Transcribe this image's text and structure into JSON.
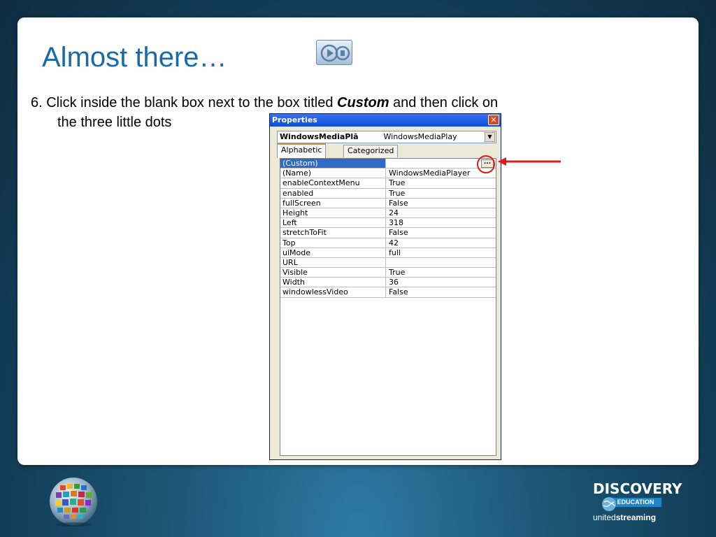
{
  "slide": {
    "title": "Almost there…",
    "instruction": {
      "line1_before": "6.  Click inside the blank box next to the box titled ",
      "emphasis": "Custom",
      "line1_after": " and then click on",
      "line2": "the three little dots"
    }
  },
  "properties_window": {
    "title": "Properties",
    "close_glyph": "✕",
    "object_name": "WindowsMediaPlā",
    "object_type": "WindowsMediaPlay",
    "dropdown_glyph": "▼",
    "tabs": [
      "Alphabetic",
      "Categorized"
    ],
    "active_tab": "Alphabetic",
    "ellipsis_label": "...",
    "rows": [
      {
        "name": "(Custom)",
        "value": ""
      },
      {
        "name": "(Name)",
        "value": "WindowsMediaPlayer"
      },
      {
        "name": "enableContextMenu",
        "value": "True"
      },
      {
        "name": "enabled",
        "value": "True"
      },
      {
        "name": "fullScreen",
        "value": "False"
      },
      {
        "name": "Height",
        "value": "24"
      },
      {
        "name": "Left",
        "value": "318"
      },
      {
        "name": "stretchToFit",
        "value": "False"
      },
      {
        "name": "Top",
        "value": "42"
      },
      {
        "name": "uiMode",
        "value": "full"
      },
      {
        "name": "URL",
        "value": ""
      },
      {
        "name": "Visible",
        "value": "True"
      },
      {
        "name": "Width",
        "value": "36"
      },
      {
        "name": "windowlessVideo",
        "value": "False"
      }
    ],
    "selected_row": "(Custom)"
  },
  "annotation": {
    "highlight_color": "#e0191b"
  },
  "footer": {
    "brand": "DISCOVERY",
    "sub_brand": "EDUCATION",
    "product_prefix": "united",
    "product_suffix": "streaming"
  },
  "colors": {
    "title": "#1a6aa8",
    "background": "#123c55",
    "selection": "#316ac5"
  },
  "icons": [
    "media-player-icon",
    "close-icon",
    "chevron-down-icon",
    "ellipsis-icon",
    "arrow-left-icon",
    "globe-logo-icon"
  ]
}
